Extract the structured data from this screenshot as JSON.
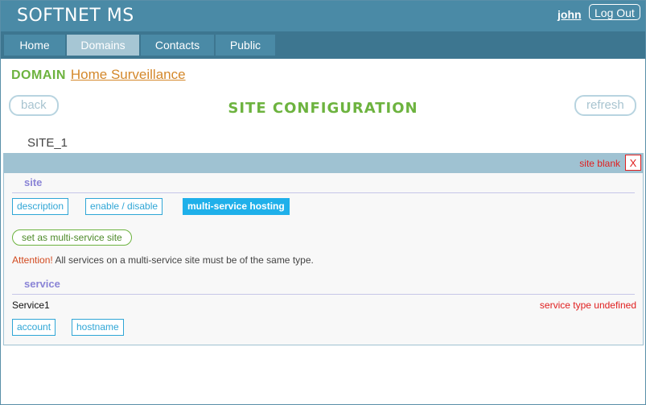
{
  "header": {
    "brand": "SOFTNET MS",
    "user": "john",
    "logout_label": "Log Out"
  },
  "nav": {
    "tabs": [
      {
        "label": "Home",
        "active": false
      },
      {
        "label": "Domains",
        "active": true
      },
      {
        "label": "Contacts",
        "active": false
      },
      {
        "label": "Public",
        "active": false
      }
    ]
  },
  "domain": {
    "label": "DOMAIN",
    "name": "Home Surveillance"
  },
  "toolbar": {
    "back_label": "back",
    "refresh_label": "refresh"
  },
  "page_title": "SITE CONFIGURATION",
  "site": {
    "name": "SITE_1",
    "status": "site blank",
    "close_label": "X",
    "section_label": "site",
    "tabs": [
      {
        "label": "description",
        "active": false
      },
      {
        "label": "enable / disable",
        "active": false
      },
      {
        "label": "multi-service hosting",
        "active": true
      }
    ],
    "multi_button_label": "set as multi-service site",
    "attention_label": "Attention!",
    "attention_text": " All services on a multi-service site must be of the same type."
  },
  "service": {
    "section_label": "service",
    "name": "Service1",
    "type_status": "service type undefined",
    "tabs": [
      {
        "label": "account"
      },
      {
        "label": "hostname"
      }
    ]
  },
  "colors": {
    "accent": "#4a8aa6",
    "nav": "#3d7690",
    "title_green": "#6db33f",
    "link_orange": "#d4882b",
    "error_red": "#e02020",
    "tag_blue": "#2fa6d6"
  }
}
